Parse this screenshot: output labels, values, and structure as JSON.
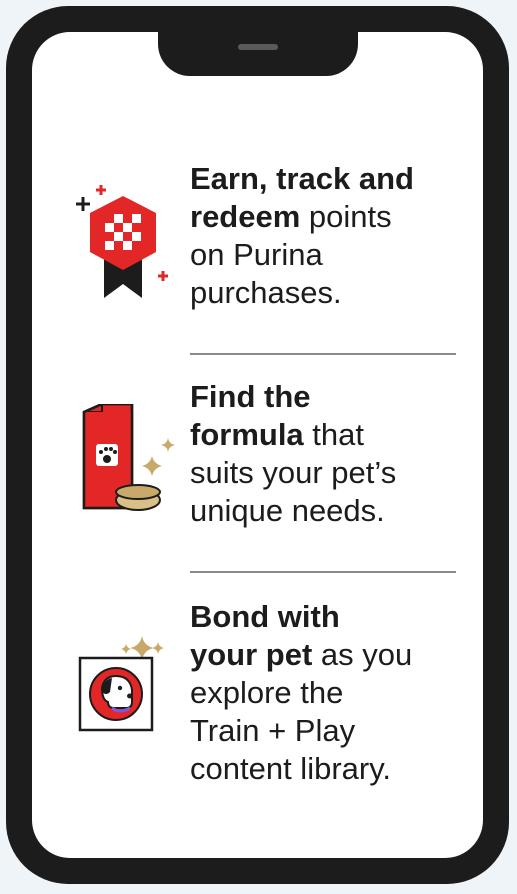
{
  "features": [
    {
      "bold_1": "Earn, track and",
      "bold_2": "redeem",
      "rest_2": " points",
      "line_3": "on Purina",
      "line_4": "purchases.",
      "icon": "checkered-badge-icon"
    },
    {
      "bold_1": "Find the",
      "bold_2": "formula",
      "rest_2": " that",
      "line_3": "suits your pet’s",
      "line_4": "unique needs.",
      "icon": "pet-food-bag-icon"
    },
    {
      "bold_1": "Bond with",
      "bold_2": "your pet",
      "rest_2": " as you",
      "line_3": "explore the",
      "line_4": "Train + Play",
      "line_5": "content library.",
      "icon": "dog-frame-icon"
    }
  ],
  "colors": {
    "brand_red": "#e32626",
    "gold": "#c9a96a",
    "ink": "#1c1c1c"
  }
}
